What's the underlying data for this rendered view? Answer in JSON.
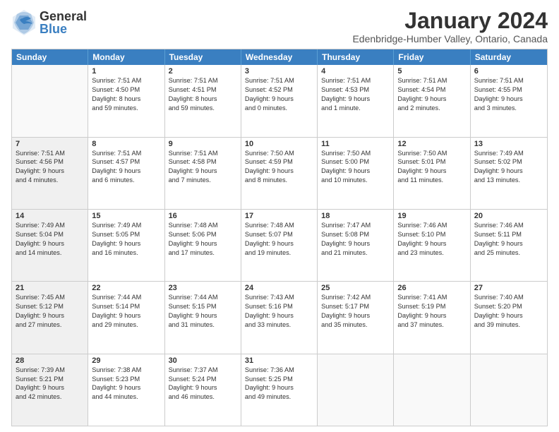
{
  "logo": {
    "general": "General",
    "blue": "Blue"
  },
  "title": {
    "month_year": "January 2024",
    "location": "Edenbridge-Humber Valley, Ontario, Canada"
  },
  "weekdays": [
    "Sunday",
    "Monday",
    "Tuesday",
    "Wednesday",
    "Thursday",
    "Friday",
    "Saturday"
  ],
  "weeks": [
    [
      {
        "day": "",
        "lines": [],
        "empty": true
      },
      {
        "day": "1",
        "lines": [
          "Sunrise: 7:51 AM",
          "Sunset: 4:50 PM",
          "Daylight: 8 hours",
          "and 59 minutes."
        ]
      },
      {
        "day": "2",
        "lines": [
          "Sunrise: 7:51 AM",
          "Sunset: 4:51 PM",
          "Daylight: 8 hours",
          "and 59 minutes."
        ]
      },
      {
        "day": "3",
        "lines": [
          "Sunrise: 7:51 AM",
          "Sunset: 4:52 PM",
          "Daylight: 9 hours",
          "and 0 minutes."
        ]
      },
      {
        "day": "4",
        "lines": [
          "Sunrise: 7:51 AM",
          "Sunset: 4:53 PM",
          "Daylight: 9 hours",
          "and 1 minute."
        ]
      },
      {
        "day": "5",
        "lines": [
          "Sunrise: 7:51 AM",
          "Sunset: 4:54 PM",
          "Daylight: 9 hours",
          "and 2 minutes."
        ]
      },
      {
        "day": "6",
        "lines": [
          "Sunrise: 7:51 AM",
          "Sunset: 4:55 PM",
          "Daylight: 9 hours",
          "and 3 minutes."
        ]
      }
    ],
    [
      {
        "day": "7",
        "lines": [
          "Sunrise: 7:51 AM",
          "Sunset: 4:56 PM",
          "Daylight: 9 hours",
          "and 4 minutes."
        ],
        "shaded": true
      },
      {
        "day": "8",
        "lines": [
          "Sunrise: 7:51 AM",
          "Sunset: 4:57 PM",
          "Daylight: 9 hours",
          "and 6 minutes."
        ]
      },
      {
        "day": "9",
        "lines": [
          "Sunrise: 7:51 AM",
          "Sunset: 4:58 PM",
          "Daylight: 9 hours",
          "and 7 minutes."
        ]
      },
      {
        "day": "10",
        "lines": [
          "Sunrise: 7:50 AM",
          "Sunset: 4:59 PM",
          "Daylight: 9 hours",
          "and 8 minutes."
        ]
      },
      {
        "day": "11",
        "lines": [
          "Sunrise: 7:50 AM",
          "Sunset: 5:00 PM",
          "Daylight: 9 hours",
          "and 10 minutes."
        ]
      },
      {
        "day": "12",
        "lines": [
          "Sunrise: 7:50 AM",
          "Sunset: 5:01 PM",
          "Daylight: 9 hours",
          "and 11 minutes."
        ]
      },
      {
        "day": "13",
        "lines": [
          "Sunrise: 7:49 AM",
          "Sunset: 5:02 PM",
          "Daylight: 9 hours",
          "and 13 minutes."
        ]
      }
    ],
    [
      {
        "day": "14",
        "lines": [
          "Sunrise: 7:49 AM",
          "Sunset: 5:04 PM",
          "Daylight: 9 hours",
          "and 14 minutes."
        ],
        "shaded": true
      },
      {
        "day": "15",
        "lines": [
          "Sunrise: 7:49 AM",
          "Sunset: 5:05 PM",
          "Daylight: 9 hours",
          "and 16 minutes."
        ]
      },
      {
        "day": "16",
        "lines": [
          "Sunrise: 7:48 AM",
          "Sunset: 5:06 PM",
          "Daylight: 9 hours",
          "and 17 minutes."
        ]
      },
      {
        "day": "17",
        "lines": [
          "Sunrise: 7:48 AM",
          "Sunset: 5:07 PM",
          "Daylight: 9 hours",
          "and 19 minutes."
        ]
      },
      {
        "day": "18",
        "lines": [
          "Sunrise: 7:47 AM",
          "Sunset: 5:08 PM",
          "Daylight: 9 hours",
          "and 21 minutes."
        ]
      },
      {
        "day": "19",
        "lines": [
          "Sunrise: 7:46 AM",
          "Sunset: 5:10 PM",
          "Daylight: 9 hours",
          "and 23 minutes."
        ]
      },
      {
        "day": "20",
        "lines": [
          "Sunrise: 7:46 AM",
          "Sunset: 5:11 PM",
          "Daylight: 9 hours",
          "and 25 minutes."
        ]
      }
    ],
    [
      {
        "day": "21",
        "lines": [
          "Sunrise: 7:45 AM",
          "Sunset: 5:12 PM",
          "Daylight: 9 hours",
          "and 27 minutes."
        ],
        "shaded": true
      },
      {
        "day": "22",
        "lines": [
          "Sunrise: 7:44 AM",
          "Sunset: 5:14 PM",
          "Daylight: 9 hours",
          "and 29 minutes."
        ]
      },
      {
        "day": "23",
        "lines": [
          "Sunrise: 7:44 AM",
          "Sunset: 5:15 PM",
          "Daylight: 9 hours",
          "and 31 minutes."
        ]
      },
      {
        "day": "24",
        "lines": [
          "Sunrise: 7:43 AM",
          "Sunset: 5:16 PM",
          "Daylight: 9 hours",
          "and 33 minutes."
        ]
      },
      {
        "day": "25",
        "lines": [
          "Sunrise: 7:42 AM",
          "Sunset: 5:17 PM",
          "Daylight: 9 hours",
          "and 35 minutes."
        ]
      },
      {
        "day": "26",
        "lines": [
          "Sunrise: 7:41 AM",
          "Sunset: 5:19 PM",
          "Daylight: 9 hours",
          "and 37 minutes."
        ]
      },
      {
        "day": "27",
        "lines": [
          "Sunrise: 7:40 AM",
          "Sunset: 5:20 PM",
          "Daylight: 9 hours",
          "and 39 minutes."
        ]
      }
    ],
    [
      {
        "day": "28",
        "lines": [
          "Sunrise: 7:39 AM",
          "Sunset: 5:21 PM",
          "Daylight: 9 hours",
          "and 42 minutes."
        ],
        "shaded": true
      },
      {
        "day": "29",
        "lines": [
          "Sunrise: 7:38 AM",
          "Sunset: 5:23 PM",
          "Daylight: 9 hours",
          "and 44 minutes."
        ]
      },
      {
        "day": "30",
        "lines": [
          "Sunrise: 7:37 AM",
          "Sunset: 5:24 PM",
          "Daylight: 9 hours",
          "and 46 minutes."
        ]
      },
      {
        "day": "31",
        "lines": [
          "Sunrise: 7:36 AM",
          "Sunset: 5:25 PM",
          "Daylight: 9 hours",
          "and 49 minutes."
        ]
      },
      {
        "day": "",
        "lines": [],
        "empty": true
      },
      {
        "day": "",
        "lines": [],
        "empty": true
      },
      {
        "day": "",
        "lines": [],
        "empty": true
      }
    ]
  ]
}
